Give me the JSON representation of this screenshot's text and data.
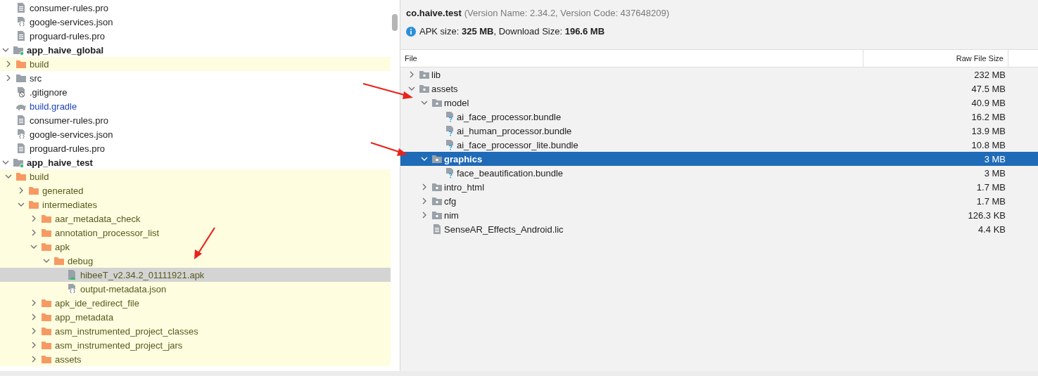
{
  "project_tree": {
    "items": [
      {
        "children": [
          {
            "label": "consumer-rules.pro",
            "kind": "file"
          },
          {
            "label": "google-services.json",
            "kind": "json"
          },
          {
            "label": "proguard-rules.pro",
            "kind": "file"
          }
        ]
      },
      {
        "label": "app_haive_global",
        "kind": "module",
        "expanded": true,
        "children": [
          {
            "label": "build",
            "kind": "folder",
            "excluded": true,
            "expanded": false
          },
          {
            "label": "src",
            "kind": "folder",
            "excluded": false,
            "expanded": false
          },
          {
            "label": ".gitignore",
            "kind": "gitignore"
          },
          {
            "label": "build.gradle",
            "kind": "gradle",
            "modified": true
          },
          {
            "label": "consumer-rules.pro",
            "kind": "file"
          },
          {
            "label": "google-services.json",
            "kind": "json"
          },
          {
            "label": "proguard-rules.pro",
            "kind": "file"
          }
        ]
      },
      {
        "label": "app_haive_test",
        "kind": "module",
        "expanded": true,
        "children": [
          {
            "label": "build",
            "kind": "folder",
            "excluded": true,
            "expanded": true,
            "children": [
              {
                "label": "generated",
                "kind": "folder",
                "excluded": true,
                "expanded": false
              },
              {
                "label": "intermediates",
                "kind": "folder",
                "excluded": true,
                "expanded": true,
                "children": [
                  {
                    "label": "aar_metadata_check",
                    "kind": "folder",
                    "excluded": true,
                    "expanded": false
                  },
                  {
                    "label": "annotation_processor_list",
                    "kind": "folder",
                    "excluded": true,
                    "expanded": false
                  },
                  {
                    "label": "apk",
                    "kind": "folder",
                    "excluded": true,
                    "expanded": true,
                    "children": [
                      {
                        "label": "debug",
                        "kind": "folder",
                        "excluded": true,
                        "expanded": true,
                        "children": [
                          {
                            "label": "hibeeT_v2.34.2_01111921.apk",
                            "kind": "apk",
                            "excluded": true,
                            "selected": true
                          },
                          {
                            "label": "output-metadata.json",
                            "kind": "json",
                            "excluded": true,
                            "selected": false
                          }
                        ]
                      }
                    ]
                  },
                  {
                    "label": "apk_ide_redirect_file",
                    "kind": "folder",
                    "excluded": true,
                    "expanded": false
                  },
                  {
                    "label": "app_metadata",
                    "kind": "folder",
                    "excluded": true,
                    "expanded": false
                  },
                  {
                    "label": "asm_instrumented_project_classes",
                    "kind": "folder",
                    "excluded": true,
                    "expanded": false
                  },
                  {
                    "label": "asm_instrumented_project_jars",
                    "kind": "folder",
                    "excluded": true,
                    "expanded": false
                  },
                  {
                    "label": "assets",
                    "kind": "folder",
                    "excluded": true,
                    "expanded": false
                  }
                ]
              }
            ]
          }
        ]
      }
    ]
  },
  "apk_analyzer": {
    "package": "co.haive.test",
    "version_info": "(Version Name: 2.34.2, Version Code: 437648209)",
    "size_info": "APK size: **325 MB**, Download Size: **196.6 MB**",
    "columns": [
      "File",
      "Raw File Size"
    ],
    "rows": [
      {
        "name": "lib",
        "kind": "folder",
        "expanded": false,
        "selected": false,
        "size": "232 MB"
      },
      {
        "name": "assets",
        "kind": "folder",
        "expanded": true,
        "selected": false,
        "size": "47.5 MB",
        "children": [
          {
            "name": "model",
            "kind": "folder",
            "expanded": true,
            "selected": false,
            "size": "40.9 MB",
            "children": [
              {
                "name": "ai_face_processor.bundle",
                "kind": "unknown",
                "selected": false,
                "size": "16.2 MB"
              },
              {
                "name": "ai_human_processor.bundle",
                "kind": "unknown",
                "selected": false,
                "size": "13.9 MB"
              },
              {
                "name": "ai_face_processor_lite.bundle",
                "kind": "unknown",
                "selected": false,
                "size": "10.8 MB"
              }
            ]
          },
          {
            "name": "graphics",
            "kind": "folder",
            "expanded": true,
            "selected": true,
            "size": "3 MB",
            "children": [
              {
                "name": "face_beautification.bundle",
                "kind": "unknown",
                "selected": false,
                "size": "3 MB"
              }
            ]
          },
          {
            "name": "intro_html",
            "kind": "folder",
            "expanded": false,
            "selected": false,
            "size": "1.7 MB"
          },
          {
            "name": "cfg",
            "kind": "folder",
            "expanded": false,
            "selected": false,
            "size": "1.7 MB"
          },
          {
            "name": "nim",
            "kind": "folder",
            "expanded": false,
            "selected": false,
            "size": "126.3 KB"
          },
          {
            "name": "SenseAR_Effects_Android.lic",
            "kind": "file",
            "selected": false,
            "size": "4.4 KB"
          }
        ]
      }
    ]
  }
}
